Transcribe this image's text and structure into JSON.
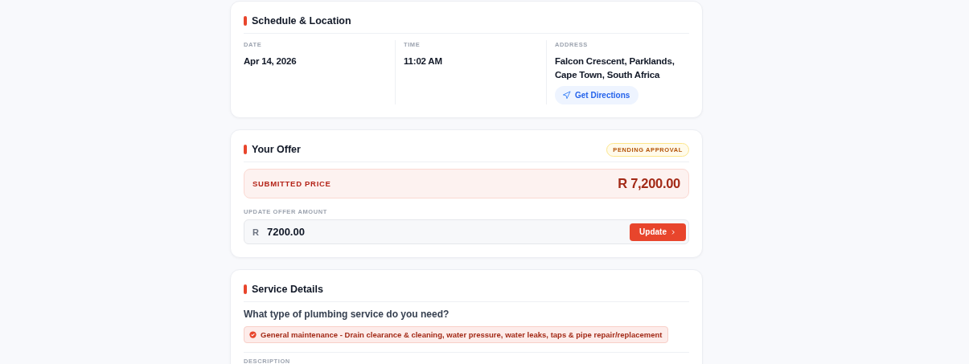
{
  "schedule": {
    "title": "Schedule & Location",
    "fields": [
      {
        "label": "DATE",
        "value": "Apr 14, 2026"
      },
      {
        "label": "TIME",
        "value": "11:02 AM"
      },
      {
        "label": "ADDRESS",
        "value": "Falcon Crescent, Parklands, Cape Town, South Africa"
      }
    ],
    "directions_button": "Get Directions"
  },
  "offer": {
    "title": "Your Offer",
    "status": "PENDING APPROVAL",
    "submitted_label": "SUBMITTED PRICE",
    "submitted_value": "R 7,200.00",
    "update_label": "UPDATE OFFER AMOUNT",
    "currency": "R",
    "amount": "7200.00",
    "update_button": "Update"
  },
  "service": {
    "title": "Service Details",
    "question": "What type of plumbing service do you need?",
    "answer": "General maintenance - Drain clearance & cleaning, water pressure, water leaks, taps & pipe repair/replacement",
    "description_label": "DESCRIPTION"
  }
}
